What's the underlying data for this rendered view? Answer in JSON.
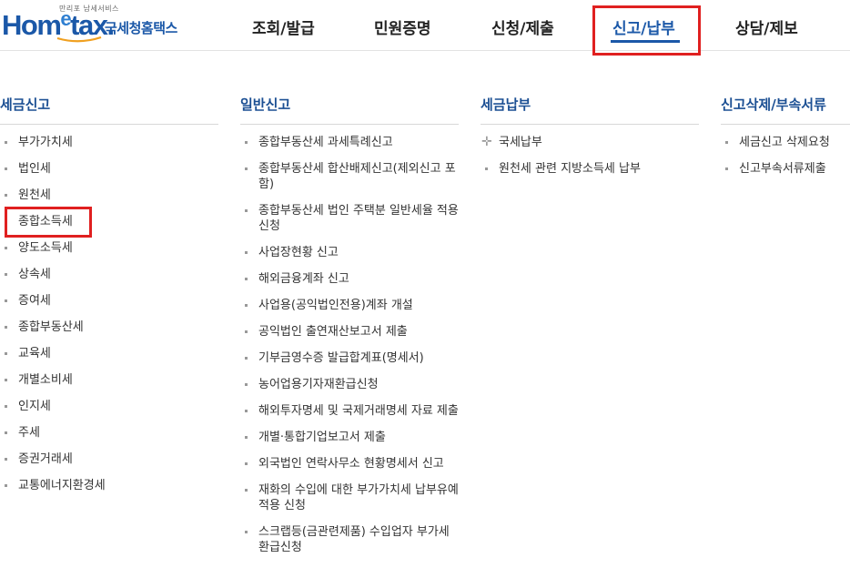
{
  "header": {
    "logo": {
      "tagline": "만리포 남세서비스",
      "brand_main": "Hom",
      "brand_e": "e",
      "brand_tail": "tax.",
      "korean_name": "국세청홈택스"
    },
    "nav": [
      {
        "label": "조회/발급"
      },
      {
        "label": "민원증명"
      },
      {
        "label": "신청/제출"
      },
      {
        "label": "신고/납부"
      },
      {
        "label": "상담/제보"
      }
    ],
    "active_nav": "신고/납부"
  },
  "columns": [
    {
      "title": "세금신고",
      "items": [
        "부가가치세",
        "법인세",
        "원천세",
        "종합소득세",
        "양도소득세",
        "상속세",
        "증여세",
        "종합부동산세",
        "교육세",
        "개별소비세",
        "인지세",
        "주세",
        "증권거래세",
        "교통에너지환경세"
      ]
    },
    {
      "title": "일반신고",
      "items": [
        "종합부동산세 과세특례신고",
        "종합부동산세 합산배제신고(제외신고 포함)",
        "종합부동산세 법인 주택분 일반세율 적용 신청",
        "사업장현황 신고",
        "해외금융계좌 신고",
        "사업용(공익법인전용)계좌 개설",
        "공익법인 출연재산보고서 제출",
        "기부금영수증 발급합계표(명세서)",
        "농어업용기자재환급신청",
        "해외투자명세 및 국제거래명세 자료 제출",
        "개별·통합기업보고서 제출",
        "외국법인 연락사무소 현황명세서 신고",
        "재화의 수입에 대한 부가가치세 납부유예 적용 신청",
        "스크랩등(금관련제품) 수입업자 부가세 환급신청"
      ]
    },
    {
      "title": "세금납부",
      "items": [
        "국세납부",
        "원천세 관련 지방소득세 납부"
      ]
    },
    {
      "title": "신고삭제/부속서류",
      "items": [
        "세금신고 삭제요청",
        "신고부속서류제출"
      ]
    }
  ],
  "highlighted_item": "종합소득세",
  "colors": {
    "brand": "#1b58a8",
    "title": "#1b4f93",
    "highlight": "#e02020"
  }
}
